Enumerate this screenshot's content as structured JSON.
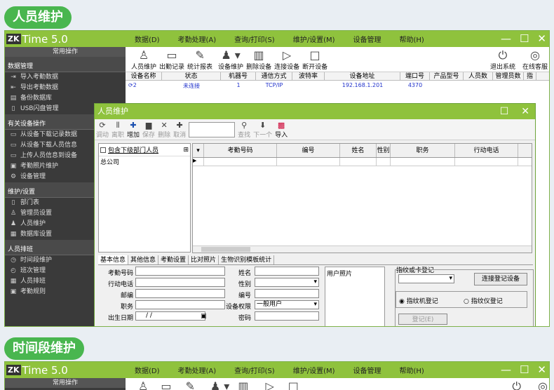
{
  "section1_title": "人员维护",
  "section2_title": "时间段维护",
  "app": {
    "logo_zk": "ZK",
    "logo_text": "Time 5.0",
    "menus": [
      "数据(D)",
      "考勤处理(A)",
      "查询/打印(S)",
      "维护/设置(M)",
      "设备管理",
      "帮助(H)"
    ]
  },
  "sidebar": {
    "header": "常用操作",
    "sections": [
      {
        "title": "数据管理",
        "items": [
          "导入考勤数据",
          "导出考勤数据",
          "备份数据库",
          "USB闪盘管理"
        ]
      },
      {
        "title": "有关设备操作",
        "items": [
          "从设备下载记录数据",
          "从设备下载人员信息",
          "上传人员信息到设备",
          "考勤照片维护",
          "设备管理"
        ]
      },
      {
        "title": "维护/设置",
        "items": [
          "部门表",
          "管理员设置",
          "人员维护",
          "数据库设置"
        ]
      },
      {
        "title": "人员排班",
        "items": [
          "时间段维护",
          "班次管理",
          "人员排班",
          "考勤规则"
        ]
      }
    ]
  },
  "toolbar": {
    "buttons": [
      "人员维护",
      "出勤记录",
      "统计报表",
      "设备维护",
      "删除设备",
      "连接设备",
      "断开设备"
    ],
    "right_buttons": [
      "退出系统",
      "在线客服"
    ]
  },
  "device_table": {
    "headers": [
      "设备名称",
      "状态",
      "机器号",
      "通信方式",
      "波特率",
      "设备地址",
      "端口号",
      "产品型号",
      "人员数",
      "管理员数",
      "指"
    ],
    "row": {
      "name": "2",
      "status": "未连接",
      "machine": "1",
      "comm": "TCP/IP",
      "baud": "",
      "addr": "192.168.1.201",
      "port": "4370"
    }
  },
  "dialog": {
    "title": "人员维护",
    "toolbar": [
      "调动",
      "离职",
      "增加",
      "保存",
      "删除",
      "取消",
      "查找",
      "下一个",
      "导入"
    ],
    "tree_checkbox": "包含下级部门人员",
    "tree_root": "总公司",
    "grid_headers": [
      "考勤号码",
      "编号",
      "姓名",
      "性别",
      "职务",
      "行动电话"
    ],
    "tabs": [
      "基本信息",
      "其他信息",
      "考勤设置",
      "比对照片",
      "生物识别模板统计"
    ],
    "form": {
      "left_labels": [
        "考勤号码",
        "行动电话",
        "邮编",
        "职务",
        "出生日期"
      ],
      "right_labels": [
        "姓名",
        "性别",
        "编号",
        "设备权限",
        "密码"
      ],
      "birth_value": "/ /",
      "privilege_value": "一般用户"
    },
    "photo_label": "用户照片",
    "fp_title": "指纹或卡登记",
    "fp_button": "连接登记设备",
    "radio1": "指纹机登记",
    "radio2": "指纹仪登记",
    "register_button": "登记(E)"
  }
}
